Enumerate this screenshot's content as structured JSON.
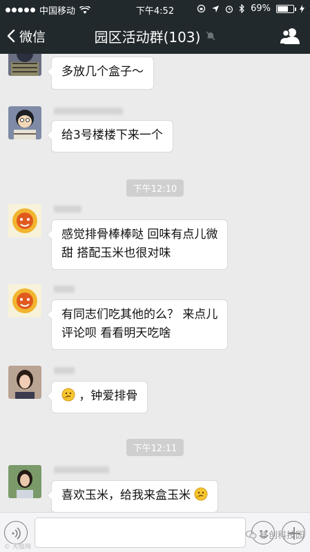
{
  "status_bar": {
    "carrier": "中国移动",
    "time": "下午4:52",
    "battery": "69%",
    "battery_level": 0.69
  },
  "nav": {
    "back_label": "微信",
    "title": "园区活动群(103)"
  },
  "messages": [
    {
      "text": "多放几个盒子～"
    },
    {
      "text": "给3号楼楼下来一个"
    },
    {
      "line1": "感觉排骨棒棒哒 回味有点儿微",
      "line2": "甜 搭配玉米也很对味"
    },
    {
      "line1": "有同志们吃其他的么？ 来点儿",
      "line2": "评论呗 看看明天吃啥"
    },
    {
      "text": "，钟爱排骨"
    },
    {
      "text": "喜欢玉米，给我来盒玉米"
    }
  ],
  "timestamps": [
    "下午12:10",
    "下午12:11"
  ],
  "watermark": {
    "left": "© 天极网",
    "right": "移创科技园"
  },
  "icons": {
    "back": "chevron-left-icon",
    "mute": "mute-icon",
    "members": "people-icon",
    "voice": "voice-icon",
    "emoji": "smile-face-icon",
    "add": "plus-icon",
    "bubble_emoji": "thinking-face-icon"
  }
}
